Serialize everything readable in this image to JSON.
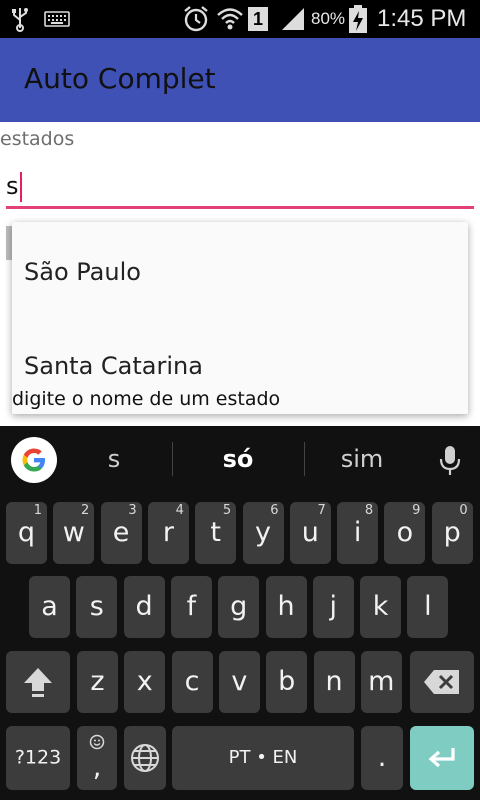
{
  "status_bar": {
    "sim_badge": "1",
    "battery_percent": "80%",
    "time": "1:45 PM",
    "icons": [
      "usb-icon",
      "keyboard-icon",
      "alarm-icon",
      "wifi-icon",
      "signal-icon",
      "battery-charging-icon"
    ]
  },
  "app_bar": {
    "title": "Auto Complet",
    "color": "#3f51b5"
  },
  "form": {
    "label": "estados",
    "input_value": "s",
    "accent_color": "#e3407a"
  },
  "dropdown": {
    "items": [
      "São Paulo",
      "Santa Catarina"
    ],
    "hint": "digite o nome de um estado"
  },
  "keyboard": {
    "suggestions": [
      "s",
      "só",
      "sim"
    ],
    "row1": [
      {
        "label": "q",
        "num": "1"
      },
      {
        "label": "w",
        "num": "2"
      },
      {
        "label": "e",
        "num": "3"
      },
      {
        "label": "r",
        "num": "4"
      },
      {
        "label": "t",
        "num": "5"
      },
      {
        "label": "y",
        "num": "6"
      },
      {
        "label": "u",
        "num": "7"
      },
      {
        "label": "i",
        "num": "8"
      },
      {
        "label": "o",
        "num": "9"
      },
      {
        "label": "p",
        "num": "0"
      }
    ],
    "row2": [
      "a",
      "s",
      "d",
      "f",
      "g",
      "h",
      "j",
      "k",
      "l"
    ],
    "row3": [
      "z",
      "x",
      "c",
      "v",
      "b",
      "n",
      "m"
    ],
    "symbols_label": "?123",
    "emoji_comma_label": ",",
    "space_label": "PT • EN",
    "period_label": ".",
    "enter_color": "#7fcdc2"
  }
}
